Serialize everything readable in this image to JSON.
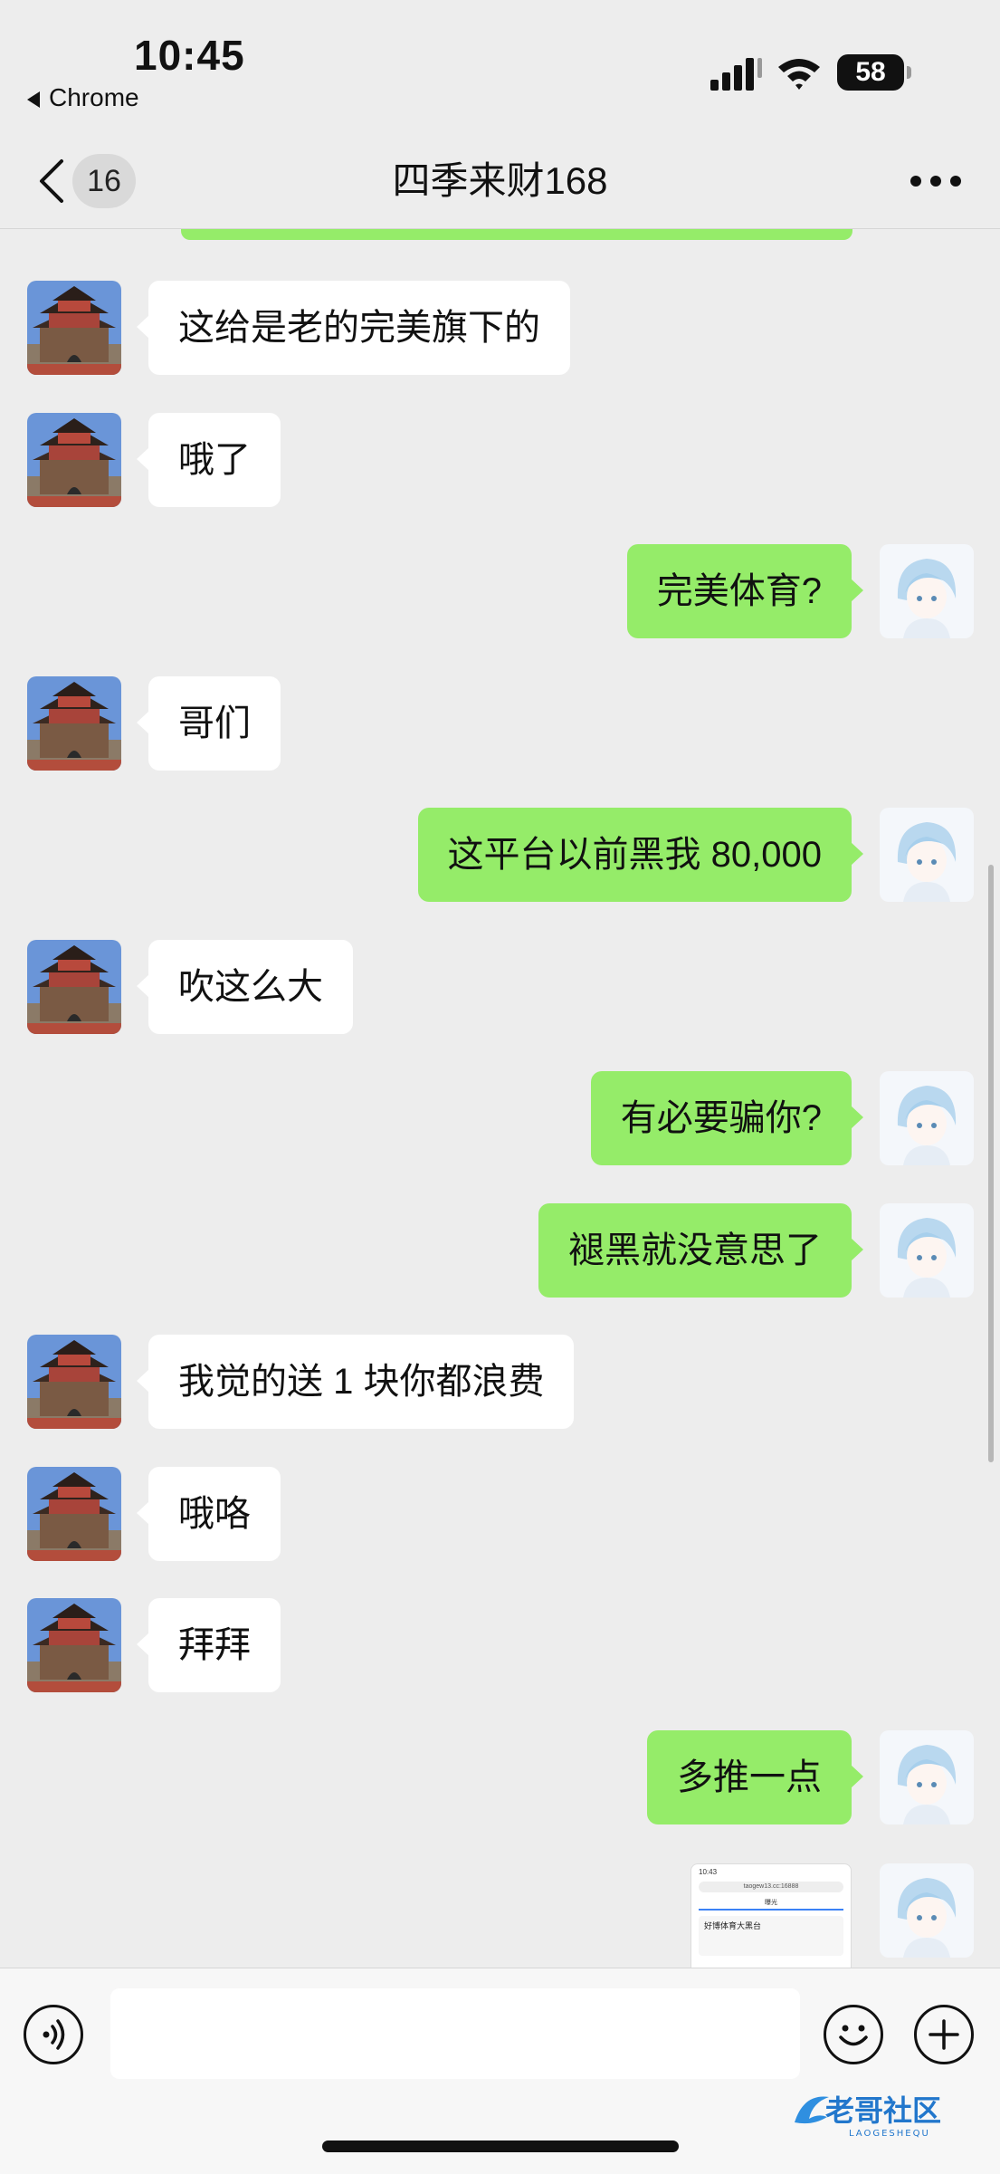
{
  "status_bar": {
    "time": "10:45",
    "back_app": "Chrome",
    "battery": "58"
  },
  "nav": {
    "unread_count": "16",
    "title": "四季来财168"
  },
  "messages": [
    {
      "side": "in",
      "text": "这给是老的完美旗下的"
    },
    {
      "side": "in",
      "text": "哦了"
    },
    {
      "side": "out",
      "text": "完美体育?"
    },
    {
      "side": "in",
      "text": "哥们"
    },
    {
      "side": "out",
      "text": "这平台以前黑我 80,000"
    },
    {
      "side": "in",
      "text": "吹这么大"
    },
    {
      "side": "out",
      "text": "有必要骗你?"
    },
    {
      "side": "out",
      "text": "褪黑就没意思了"
    },
    {
      "side": "in",
      "text": "我觉的送 1 块你都浪费"
    },
    {
      "side": "in",
      "text": "哦咯"
    },
    {
      "side": "in",
      "text": "拜拜"
    },
    {
      "side": "out",
      "text": "多推一点"
    }
  ],
  "screenshot_thumb": {
    "time": "10:43",
    "url": "taogew13.cc:16888",
    "tab": "曝光",
    "title": "好博体育大黑台"
  },
  "input": {
    "placeholder": ""
  },
  "watermark": {
    "text": "老哥社区",
    "sub": "LAOGESHEQU"
  },
  "colors": {
    "background": "#ededed",
    "outgoing_bubble": "#95ec69",
    "incoming_bubble": "#ffffff"
  }
}
